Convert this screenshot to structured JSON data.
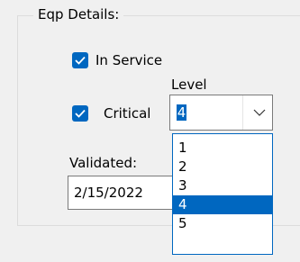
{
  "group": {
    "title": "Eqp Details:"
  },
  "in_service": {
    "label": "In Service",
    "checked": true
  },
  "critical": {
    "label": "Critical",
    "checked": true
  },
  "level": {
    "label": "Level",
    "selected": "4",
    "options": [
      "1",
      "2",
      "3",
      "4",
      "5"
    ]
  },
  "validated": {
    "label": "Validated:",
    "value": "2/15/2022"
  },
  "colors": {
    "accent": "#0067c0",
    "background": "#f0f0f0"
  }
}
